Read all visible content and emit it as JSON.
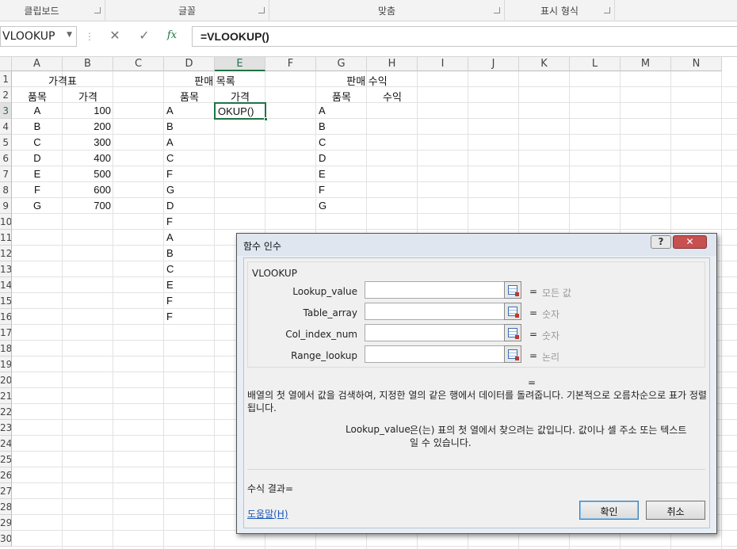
{
  "ribbon": {
    "groups": [
      {
        "label": "클립보드"
      },
      {
        "label": "글꼴"
      },
      {
        "label": "맞춤"
      },
      {
        "label": "표시 형식"
      }
    ]
  },
  "formula_bar": {
    "name_box": "VLOOKUP",
    "name_box_arrow": "▼",
    "separator": "⋮",
    "cancel_glyph": "✕",
    "enter_glyph": "✓",
    "fx_glyph": "fx",
    "formula": "=VLOOKUP()"
  },
  "columns": [
    "A",
    "B",
    "C",
    "D",
    "E",
    "F",
    "G",
    "H",
    "I",
    "J",
    "K",
    "L",
    "M",
    "N"
  ],
  "active_column": "E",
  "rows": [
    "1",
    "2",
    "3",
    "4",
    "5",
    "6",
    "7",
    "8",
    "9",
    "10",
    "11",
    "12",
    "13",
    "14",
    "15",
    "16",
    "17",
    "18",
    "19",
    "20",
    "21",
    "22",
    "23",
    "24",
    "25",
    "26",
    "27",
    "28",
    "29",
    "30"
  ],
  "active_row": "3",
  "sheet": {
    "price_table": {
      "title": "가격표",
      "headers": [
        "품목",
        "가격"
      ],
      "items": [
        "A",
        "B",
        "C",
        "D",
        "E",
        "F",
        "G"
      ],
      "prices": [
        "100",
        "200",
        "300",
        "400",
        "500",
        "600",
        "700"
      ]
    },
    "sales_list": {
      "title": "판매 목록",
      "headers": [
        "품목",
        "가격"
      ],
      "items": [
        "A",
        "B",
        "A",
        "C",
        "F",
        "G",
        "D",
        "F",
        "A",
        "B",
        "C",
        "E",
        "F",
        "F"
      ],
      "active_cell_text": "OKUP()"
    },
    "sales_revenue": {
      "title": "판매 수익",
      "headers": [
        "품목",
        "수익"
      ],
      "items": [
        "A",
        "B",
        "C",
        "D",
        "E",
        "F",
        "G"
      ]
    }
  },
  "dialog": {
    "title": "함수 인수",
    "help_glyph": "?",
    "close_glyph": "✕",
    "function_name": "VLOOKUP",
    "arguments": [
      {
        "label": "Lookup_value",
        "value": "",
        "eq": "=",
        "hint": "모든 값"
      },
      {
        "label": "Table_array",
        "value": "",
        "eq": "=",
        "hint": "숫자"
      },
      {
        "label": "Col_index_num",
        "value": "",
        "eq": "=",
        "hint": "숫자"
      },
      {
        "label": "Range_lookup",
        "value": "",
        "eq": "=",
        "hint": "논리"
      }
    ],
    "result_eq": "=",
    "description": "배열의 첫 열에서 값을 검색하여, 지정한 열의 같은 행에서 데이터를 돌려줍니다. 기본적으로 오름차순으로 표가 정렬됩니다.",
    "arg_desc_name": "Lookup_value",
    "arg_desc_text": "은(는) 표의 첫 열에서 찾으려는 값입니다. 값이나 셀 주소 또는 텍스트일 수 있습니다.",
    "formula_result": "수식 결과=",
    "help_link": "도움말(H)",
    "ok_label": "확인",
    "cancel_label": "취소"
  }
}
